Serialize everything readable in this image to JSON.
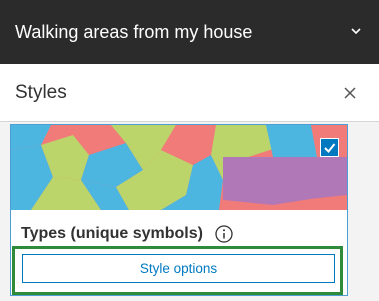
{
  "header": {
    "title": "Walking areas from my house",
    "toggle_icon": "chevron-down-icon"
  },
  "panel": {
    "title": "Styles",
    "close_icon": "close-icon"
  },
  "style_card": {
    "type_label": "Types (unique symbols)",
    "info_icon": "info-icon",
    "selected": true,
    "button_label": "Style options",
    "colors": {
      "salmon": "#f07b78",
      "green": "#bcd56b",
      "blue": "#4cb6e0",
      "purple": "#b178b8",
      "accent": "#0079c1",
      "focus": "#2f8a3a"
    }
  }
}
